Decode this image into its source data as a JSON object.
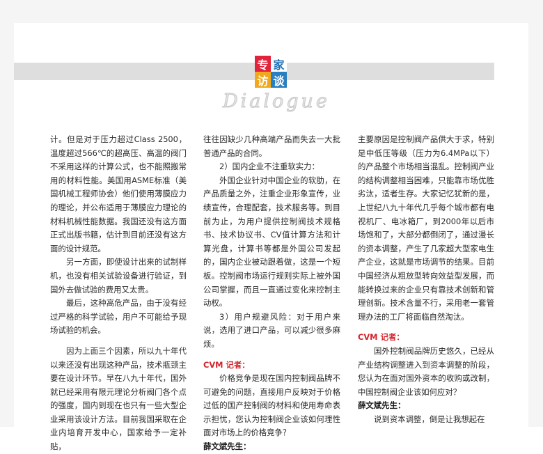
{
  "header": {
    "logo_chars": [
      "专",
      "家",
      "访",
      "谈"
    ],
    "watermark": "Dialogue"
  },
  "col1": [
    "计。但是对于压力超过Class 2500，温度超过566℃的超高压、高温的阀门不采用这样的计算公式，也不能照搬常用的材料性能。美国用ASME标准（美国机械工程师协会）他们使用薄膜应力的理论，并公布适用于薄膜应力理论的材料机械性能数据。我国还没有这方面正式出版书籍，估计到目前还没有这方面的设计规范。",
    "另一方面，即使设计出来的试制样机，也没有相关试验设备进行验证，到国外去做试验的费用又太贵。",
    "最后，这种高危产品，由于没有经过严格的科学试验，用户不可能给予现场试验的机会。",
    "因为上面三个因素，所以九十年代以来还没有出现这种产品，技术瓶颈主要在设计环节。早在八九十年代，国外就已经采用有限元理论分析阀门各个点的强度，国内到现在也只有一些大型企业采用该设计方法。目前我国采取在企业内培育开发中心，国家给予一定补贴，"
  ],
  "col2": [
    "往往因缺少几种高端产品而失去一大批普通产品的合同。",
    "2）国内企业不注重软实力：",
    "外国企业针对中国企业的软肋，在产品质量之外，注重企业形象宣传，业绩宣传，合理配套，技术服务等。到目前为止，为用户提供控制阀技术规格书、技术协议书、CV值计算方法和计算光盘，计算书等都是外国公司发起的，国内企业被动跟着做，这是一个短板。控制阀市场运行规则实际上被外国公司掌握，而且一直通过变化来控制主动权。",
    "3）用户规避风险：对于用户来说，选用了进口产品，可以减少很多麻烦。",
    "CVM 记者：",
    "价格竞争是现在国内控制阀品牌不可避免的问题，直接用户反映对于价格过低的国产控制阀的材料和使用寿命表示担忧，您认为控制阀企业该如何理性面对市场上的价格竞争？",
    "薛文斌先生："
  ],
  "col3": [
    "主要原因是控制阀产品供大于求，特别是中低压等级（压力为6.4MPa以下）的产品整个市场相当混乱。控制阀产业的结构调整相当困难，只能靠市场优胜劣汰，适者生存。大家记忆犹新的是，上世纪八九十年代几乎每个城市都有电视机厂、电冰箱厂，到2000年以后市场饱和了，大部分都倒闭了，通过漫长的资本调整，产生了几家超大型家电生产企业，这就是市场调节的结果。目前中国经济从粗放型转向效益型发展，而能转换过来的企业只有靠技术创新和管理创新。技术含量不行，采用老一套管理办法的工厂将面临自然淘汰。",
    "CVM 记者：",
    "国外控制阀品牌历史悠久，已经从产业结构调整进入到资本调整的阶段，您认为在面对国外资本的收购或改制，中国控制阀企业该如何应对？",
    "薛文斌先生：",
    "说到资本调整，倒是让我想起在"
  ]
}
